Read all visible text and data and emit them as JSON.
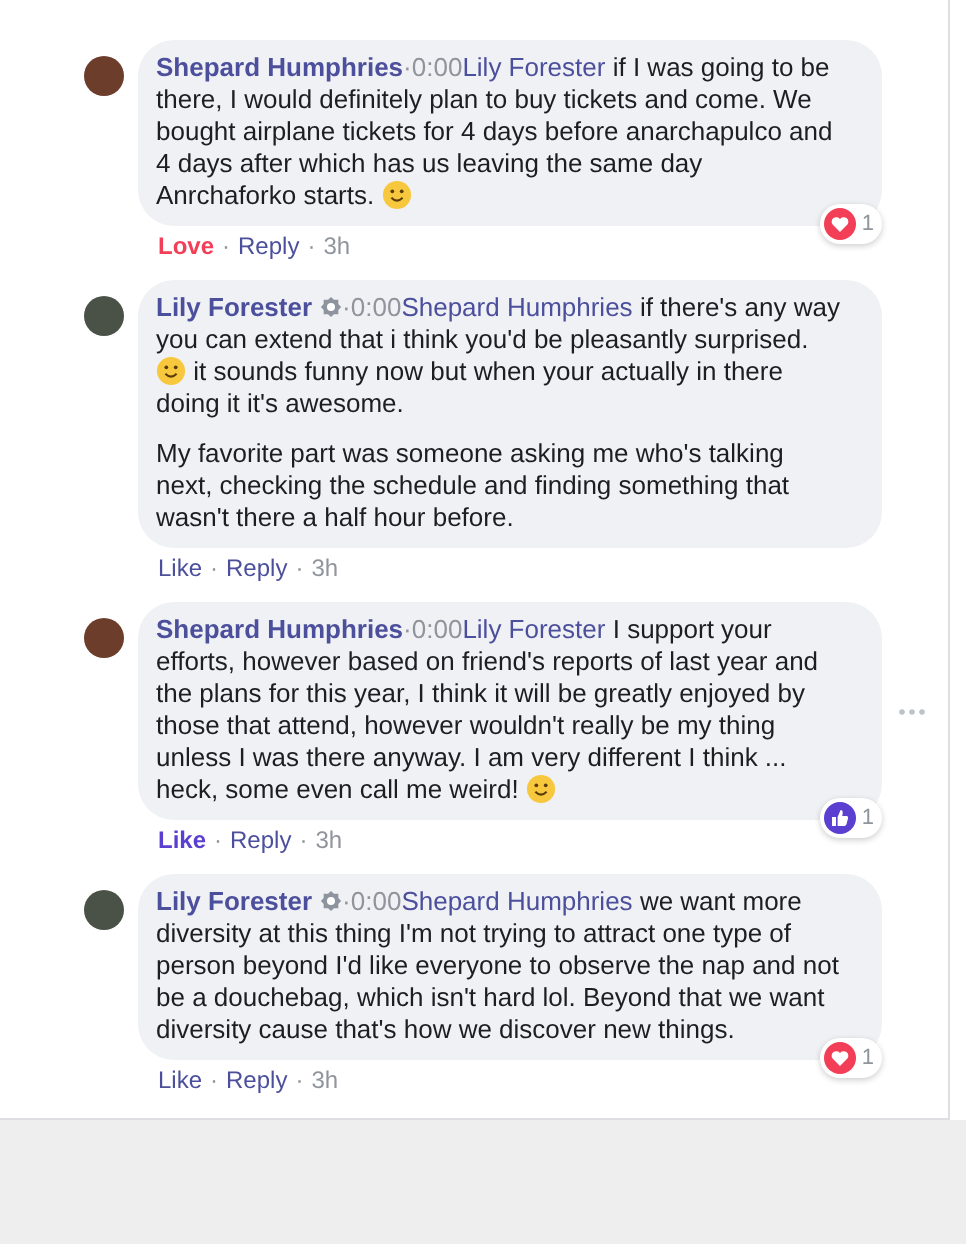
{
  "comments": [
    {
      "author": "Shepard Humphries",
      "verified": false,
      "separator": "·",
      "time": "0:00",
      "mention": "Lily Forester",
      "body": [
        [
          {
            "kind": "text",
            "text": "if I was going to be there, I would definitely plan to buy tickets and come. We bought airplane tickets for 4 days before anarchapulco and 4 days after which has us leaving the same day Anrchaforko starts."
          },
          {
            "kind": "emoji"
          }
        ]
      ],
      "reaction_label": "Love",
      "reacted": true,
      "dot_1": "·",
      "reply": "Reply",
      "dot_2": "·",
      "age": "3h",
      "reaction": {
        "kind": "love",
        "count": "1"
      },
      "more": false
    },
    {
      "author": "Lily Forester",
      "verified": true,
      "separator": "·",
      "time": "0:00",
      "mention": "Shepard Humphries",
      "body": [
        [
          {
            "kind": "text",
            "text": "if there's any way you can extend that i think you'd be pleasantly surprised."
          },
          {
            "kind": "emoji"
          },
          {
            "kind": "text",
            "text": "it sounds funny now but when your actually in there doing it it's awesome."
          }
        ],
        [
          {
            "kind": "text",
            "text": "My favorite part was someone asking me who's talking next, checking the schedule and finding something that wasn't there a half hour before."
          }
        ]
      ],
      "reaction_label": "Like",
      "reacted": false,
      "dot_1": "·",
      "reply": "Reply",
      "dot_2": "·",
      "age": "3h",
      "more": false
    },
    {
      "author": "Shepard Humphries",
      "verified": false,
      "separator": "·",
      "time": "0:00",
      "mention": "Lily Forester",
      "body": [
        [
          {
            "kind": "text",
            "text": "I support your efforts, however based on friend's reports of last year and the plans for this year, I think it will be greatly enjoyed by those that attend, however wouldn't really be my thing unless I was there anyway. I am very different I think ... heck, some even call me weird!"
          },
          {
            "kind": "emoji"
          }
        ]
      ],
      "reaction_label": "Like",
      "reacted": true,
      "dot_1": "·",
      "reply": "Reply",
      "dot_2": "·",
      "age": "3h",
      "reaction": {
        "kind": "like",
        "count": "1"
      },
      "more": true
    },
    {
      "author": "Lily Forester",
      "verified": true,
      "separator": "·",
      "time": "0:00",
      "mention": "Shepard Humphries",
      "body": [
        [
          {
            "kind": "text",
            "text": "we want more diversity at this thing I'm not trying to attract one type of person beyond I'd like everyone to observe the nap and not be a douchebag, which isn't hard lol. Beyond that we want diversity cause that's how we discover new things."
          }
        ]
      ],
      "reaction_label": "Like",
      "reacted": false,
      "dot_1": "·",
      "reply": "Reply",
      "dot_2": "·",
      "age": "3h",
      "reaction": {
        "kind": "love",
        "count": "1"
      },
      "more": false
    }
  ]
}
